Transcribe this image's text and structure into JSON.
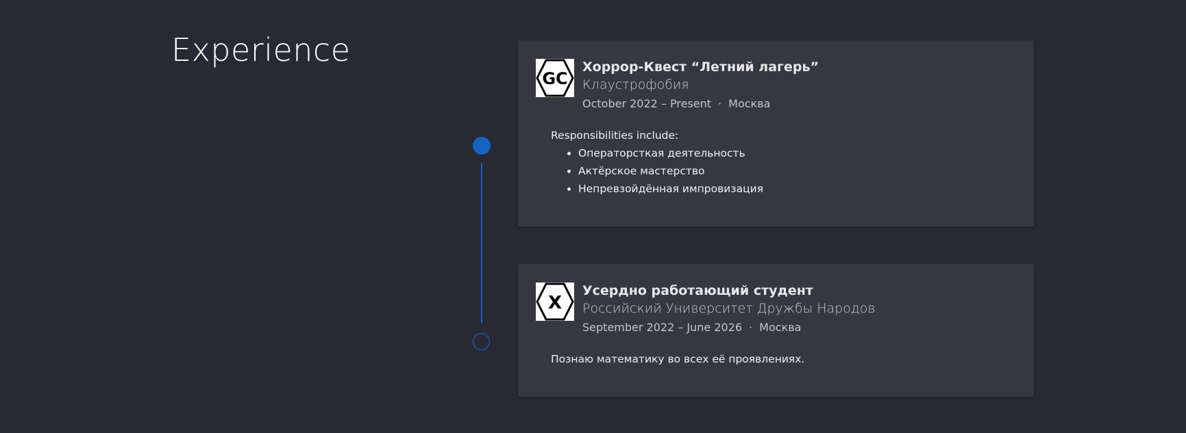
{
  "section": {
    "title": "Experience"
  },
  "timeline": {
    "accent_color": "#1565c0"
  },
  "experience": [
    {
      "logo_icon": "gc-hexagon-logo",
      "logo_text": "GC",
      "role": "Хоррор-Квест “Летний лагерь”",
      "organization": "Клаустрофобия",
      "dates": "October 2022 – Present",
      "separator": "·",
      "location": "Москва",
      "intro": "Responsibilities include:",
      "items": [
        "Операторсткая деятельность",
        "Актёрское мастерство",
        "Непревзойдённая импровизация"
      ]
    },
    {
      "logo_icon": "x-hexagon-logo",
      "logo_text": "X",
      "role": "Усердно работающий студент",
      "organization": "Российский Университет Дружбы Народов",
      "dates": "September 2022 – June 2026",
      "separator": "·",
      "location": "Москва",
      "description": "Познаю математику во всех её проявлениях."
    }
  ]
}
